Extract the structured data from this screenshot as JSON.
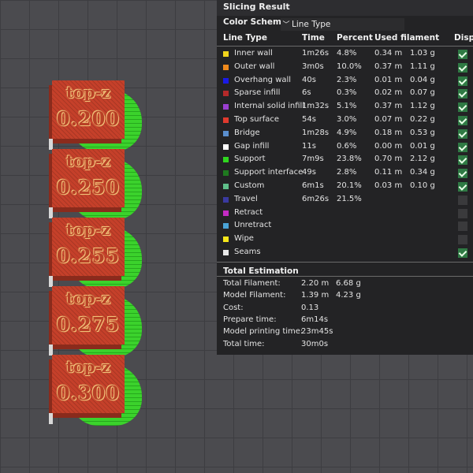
{
  "panel": {
    "title": "Slicing Result",
    "color_scheme_label": "Color Scheme",
    "color_scheme_value": "Line Type",
    "columns": [
      "Line Type",
      "Time",
      "Percent",
      "Used filament",
      "Disp"
    ],
    "rows": [
      {
        "name": "Inner wall",
        "time": "1m26s",
        "percent": "4.8%",
        "length": "0.34 m",
        "weight": "1.03 g",
        "color": "#f2d41c",
        "checked": true
      },
      {
        "name": "Outer wall",
        "time": "3m0s",
        "percent": "10.0%",
        "length": "0.37 m",
        "weight": "1.11 g",
        "color": "#f08a1c",
        "checked": true
      },
      {
        "name": "Overhang wall",
        "time": "40s",
        "percent": "2.3%",
        "length": "0.01 m",
        "weight": "0.04 g",
        "color": "#1a1ae6",
        "checked": true
      },
      {
        "name": "Sparse infill",
        "time": "6s",
        "percent": "0.3%",
        "length": "0.02 m",
        "weight": "0.07 g",
        "color": "#b52a2a",
        "checked": true
      },
      {
        "name": "Internal solid infill",
        "time": "1m32s",
        "percent": "5.1%",
        "length": "0.37 m",
        "weight": "1.12 g",
        "color": "#9a3fd0",
        "checked": true
      },
      {
        "name": "Top surface",
        "time": "54s",
        "percent": "3.0%",
        "length": "0.07 m",
        "weight": "0.22 g",
        "color": "#e03a2e",
        "checked": true
      },
      {
        "name": "Bridge",
        "time": "1m28s",
        "percent": "4.9%",
        "length": "0.18 m",
        "weight": "0.53 g",
        "color": "#5a8fcf",
        "checked": true
      },
      {
        "name": "Gap infill",
        "time": "11s",
        "percent": "0.6%",
        "length": "0.00 m",
        "weight": "0.01 g",
        "color": "#ffffff",
        "checked": true
      },
      {
        "name": "Support",
        "time": "7m9s",
        "percent": "23.8%",
        "length": "0.70 m",
        "weight": "2.12 g",
        "color": "#2fd61f",
        "checked": true
      },
      {
        "name": "Support interface",
        "time": "49s",
        "percent": "2.8%",
        "length": "0.11 m",
        "weight": "0.34 g",
        "color": "#1f7a1f",
        "checked": true
      },
      {
        "name": "Custom",
        "time": "6m1s",
        "percent": "20.1%",
        "length": "0.03 m",
        "weight": "0.10 g",
        "color": "#5fbf8a",
        "checked": true
      },
      {
        "name": "Travel",
        "time": "6m26s",
        "percent": "21.5%",
        "length": "",
        "weight": "",
        "color": "#3a3aa0",
        "checked": false
      },
      {
        "name": "Retract",
        "time": "",
        "percent": "",
        "length": "",
        "weight": "",
        "color": "#c42bc4",
        "checked": false
      },
      {
        "name": "Unretract",
        "time": "",
        "percent": "",
        "length": "",
        "weight": "",
        "color": "#4aa3d6",
        "checked": false
      },
      {
        "name": "Wipe",
        "time": "",
        "percent": "",
        "length": "",
        "weight": "",
        "color": "#f5e61a",
        "checked": false
      },
      {
        "name": "Seams",
        "time": "",
        "percent": "",
        "length": "",
        "weight": "",
        "color": "#e8e8e8",
        "checked": true
      }
    ],
    "estimation": {
      "title": "Total Estimation",
      "rows": [
        {
          "label": "Total Filament:",
          "v1": "2.20 m",
          "v2": "6.68 g"
        },
        {
          "label": "Model Filament:",
          "v1": "1.39 m",
          "v2": "4.23 g"
        },
        {
          "label": "Cost:",
          "v1": "0.13",
          "v2": ""
        },
        {
          "label": "Prepare time:",
          "v1": "6m14s",
          "v2": ""
        },
        {
          "label": "Model printing time:",
          "v1": "23m45s",
          "v2": ""
        },
        {
          "label": "Total time:",
          "v1": "30m0s",
          "v2": ""
        }
      ]
    }
  },
  "models": [
    {
      "line1": "top-z",
      "line2": "0.200"
    },
    {
      "line1": "top-z",
      "line2": "0.250"
    },
    {
      "line1": "top-z",
      "line2": "0.255"
    },
    {
      "line1": "top-z",
      "line2": "0.275"
    },
    {
      "line1": "top-z",
      "line2": "0.300"
    }
  ]
}
